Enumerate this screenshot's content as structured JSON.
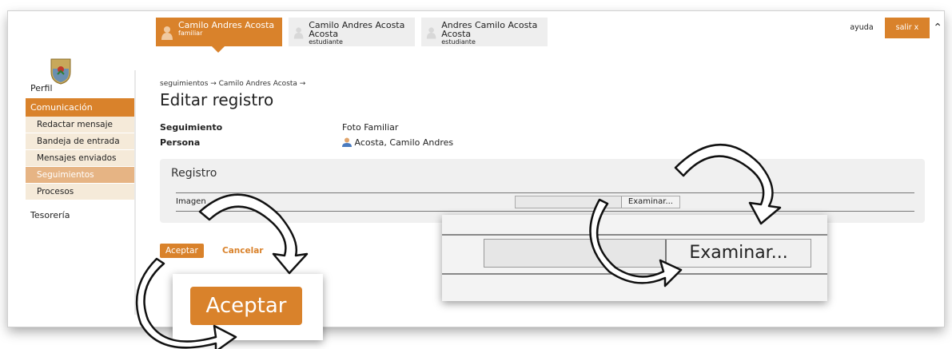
{
  "tabs": [
    {
      "name": "Camilo Andres Acosta",
      "role": "familiar",
      "active": true
    },
    {
      "name": "Camilo Andres Acosta Acosta",
      "role": "estudiante",
      "active": false
    },
    {
      "name": "Andres Camilo Acosta Acosta",
      "role": "estudiante",
      "active": false
    }
  ],
  "header": {
    "help_label": "ayuda",
    "logout_label": "salir x",
    "collapse_icon": "chevron-up-icon"
  },
  "sidebar": {
    "profile": "Perfil",
    "group": "Comunicación",
    "items": [
      {
        "label": "Redactar mensaje",
        "active": false
      },
      {
        "label": "Bandeja de entrada",
        "active": false
      },
      {
        "label": "Mensajes enviados",
        "active": false
      },
      {
        "label": "Seguimientos",
        "active": true
      },
      {
        "label": "Procesos",
        "active": false
      }
    ],
    "treasury": "Tesorería"
  },
  "breadcrumb": "seguimientos  →  Camilo Andres Acosta  →",
  "page_title": "Editar registro",
  "fields": {
    "seguimiento_label": "Seguimiento",
    "seguimiento_value": "Foto Familiar",
    "persona_label": "Persona",
    "persona_value": "Acosta, Camilo Andres"
  },
  "registro": {
    "title": "Registro",
    "image_label": "Imagen",
    "browse_label": "Examinar..."
  },
  "actions": {
    "accept_label": "Aceptar",
    "cancel_label": "Cancelar"
  },
  "colors": {
    "accent": "#d9822b",
    "panel": "#f0f0f0"
  }
}
